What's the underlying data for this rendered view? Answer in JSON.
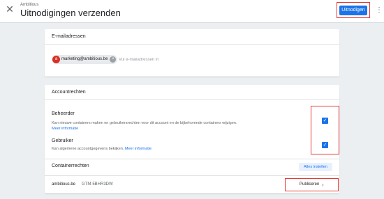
{
  "header": {
    "subtitle": "Ambitious",
    "title": "Uitnodigingen verzenden",
    "close_icon": "close-icon",
    "invite_label": "Uitnodigen",
    "more_icon": "more-vert-icon"
  },
  "email_section": {
    "heading": "E-mailadressen",
    "chips": [
      {
        "email": "marketing@ambitious.be",
        "avatar": "a"
      }
    ],
    "input_placeholder": "Vul e-mailadressen in",
    "input_value": ""
  },
  "rights_section": {
    "heading": "Accountrechten",
    "roles": [
      {
        "title": "Beheerder",
        "description": "Kan nieuwe containers maken en gebruikersrechten voor dit account en de bijbehorende containers wijzigen.",
        "link": "Meer informatie",
        "checked": true
      },
      {
        "title": "Gebruiker",
        "description": "Kan algemene accountgegevens bekijken.",
        "link": "Meer informatie",
        "checked": true
      }
    ],
    "container_rights_label": "Containerrechten",
    "set_all_label": "Alles instellen",
    "containers": [
      {
        "name": "ambitious.be",
        "id": "GTM-5BHR3DW",
        "permission": "Publiceren"
      }
    ]
  },
  "colors": {
    "accent": "#1a73e8",
    "highlight": "#e53935",
    "background": "#eceff1"
  }
}
